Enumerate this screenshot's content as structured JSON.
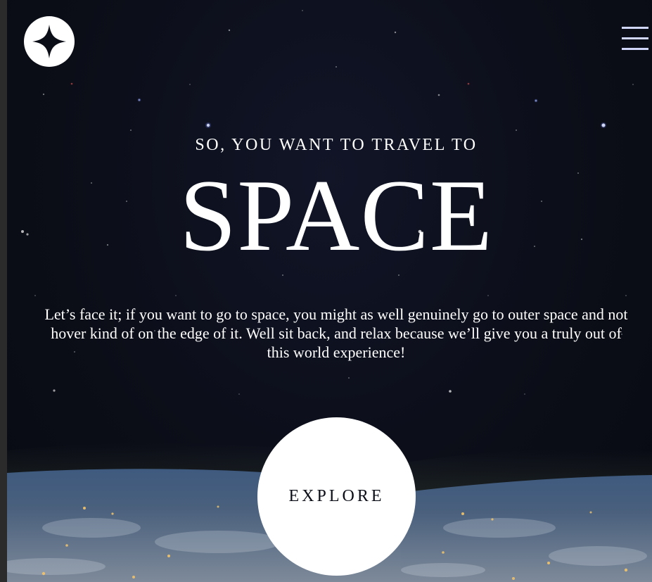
{
  "header": {
    "logo_icon": "four-point-star-icon",
    "menu_icon": "hamburger-menu-icon"
  },
  "hero": {
    "eyebrow": "SO, YOU WANT TO TRAVEL TO",
    "title": "SPACE",
    "body": "Let’s face it; if you want to go to space, you might as well genuinely go to outer space and not hover kind of on the edge of it. Well sit back, and relax because we’ll give you a truly out of this world experience!",
    "cta_label": "EXPLORE"
  },
  "colors": {
    "background": "#0b0d17",
    "text": "#ffffff",
    "accent": "#d0d6f9",
    "cta_background": "#ffffff"
  }
}
